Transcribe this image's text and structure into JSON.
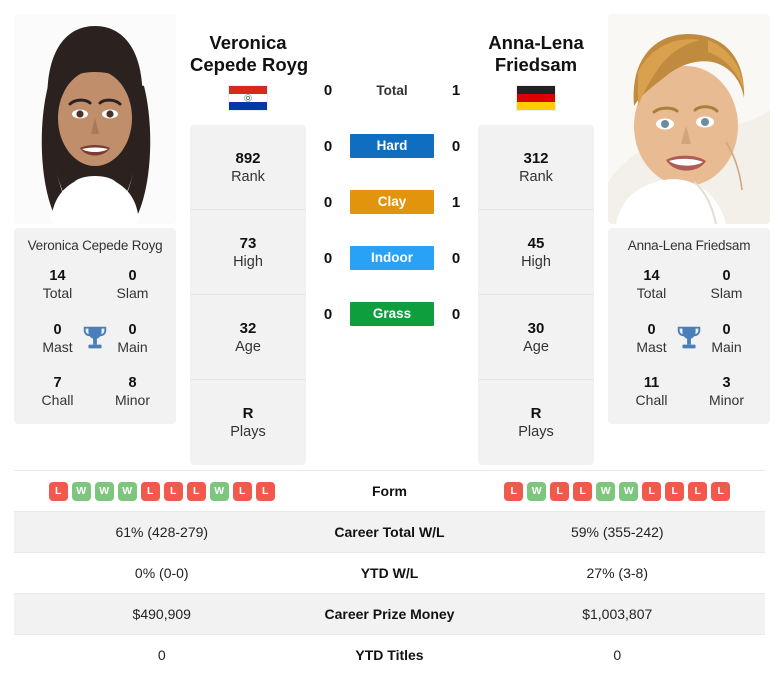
{
  "players": {
    "left": {
      "name_line1": "Veronica",
      "name_line2": "Cepede Royg",
      "caption": "Veronica Cepede Royg",
      "country": "Paraguay",
      "flag_icon": "flag-paraguay",
      "rank": "892",
      "rank_label": "Rank",
      "high": "73",
      "high_label": "High",
      "age": "32",
      "age_label": "Age",
      "plays": "R",
      "plays_label": "Plays",
      "titles": {
        "total": "14",
        "total_label": "Total",
        "slam": "0",
        "slam_label": "Slam",
        "mast": "0",
        "mast_label": "Mast",
        "main": "0",
        "main_label": "Main",
        "chall": "7",
        "chall_label": "Chall",
        "minor": "8",
        "minor_label": "Minor"
      },
      "form": [
        "L",
        "W",
        "W",
        "W",
        "L",
        "L",
        "L",
        "W",
        "L",
        "L"
      ],
      "career_total_wl": "61% (428-279)",
      "ytd_wl": "0% (0-0)",
      "career_prize_money": "$490,909",
      "ytd_titles": "0"
    },
    "right": {
      "name_line1": "Anna-Lena",
      "name_line2": "Friedsam",
      "caption": "Anna-Lena Friedsam",
      "country": "Germany",
      "flag_icon": "flag-germany",
      "rank": "312",
      "rank_label": "Rank",
      "high": "45",
      "high_label": "High",
      "age": "30",
      "age_label": "Age",
      "plays": "R",
      "plays_label": "Plays",
      "titles": {
        "total": "14",
        "total_label": "Total",
        "slam": "0",
        "slam_label": "Slam",
        "mast": "0",
        "mast_label": "Mast",
        "main": "0",
        "main_label": "Main",
        "chall": "11",
        "chall_label": "Chall",
        "minor": "3",
        "minor_label": "Minor"
      },
      "form": [
        "L",
        "W",
        "L",
        "L",
        "W",
        "W",
        "L",
        "L",
        "L",
        "L"
      ],
      "career_total_wl": "59% (355-242)",
      "ytd_wl": "27% (3-8)",
      "career_prize_money": "$1,003,807",
      "ytd_titles": "0"
    }
  },
  "head_to_head": {
    "total": {
      "label": "Total",
      "left": "0",
      "right": "1"
    },
    "surfaces": [
      {
        "label": "Hard",
        "left": "0",
        "right": "0",
        "color": "#0f6ec0"
      },
      {
        "label": "Clay",
        "left": "0",
        "right": "1",
        "color": "#e2940c"
      },
      {
        "label": "Indoor",
        "left": "0",
        "right": "0",
        "color": "#29a1f5"
      },
      {
        "label": "Grass",
        "left": "0",
        "right": "0",
        "color": "#0e9e3e"
      }
    ]
  },
  "comparison_rows": [
    {
      "label": "Form",
      "left": "",
      "right": "",
      "type": "form"
    },
    {
      "label": "Career Total W/L",
      "left": "61% (428-279)",
      "right": "59% (355-242)",
      "type": "text"
    },
    {
      "label": "YTD W/L",
      "left": "0% (0-0)",
      "right": "27% (3-8)",
      "type": "text"
    },
    {
      "label": "Career Prize Money",
      "left": "$490,909",
      "right": "$1,003,807",
      "type": "text"
    },
    {
      "label": "YTD Titles",
      "left": "0",
      "right": "0",
      "type": "text"
    }
  ],
  "colors": {
    "win_badge": "#7ec57e",
    "loss_badge": "#ef5a4c",
    "card_bg": "#f2f2f2",
    "trophy": "#4a7ebb"
  }
}
